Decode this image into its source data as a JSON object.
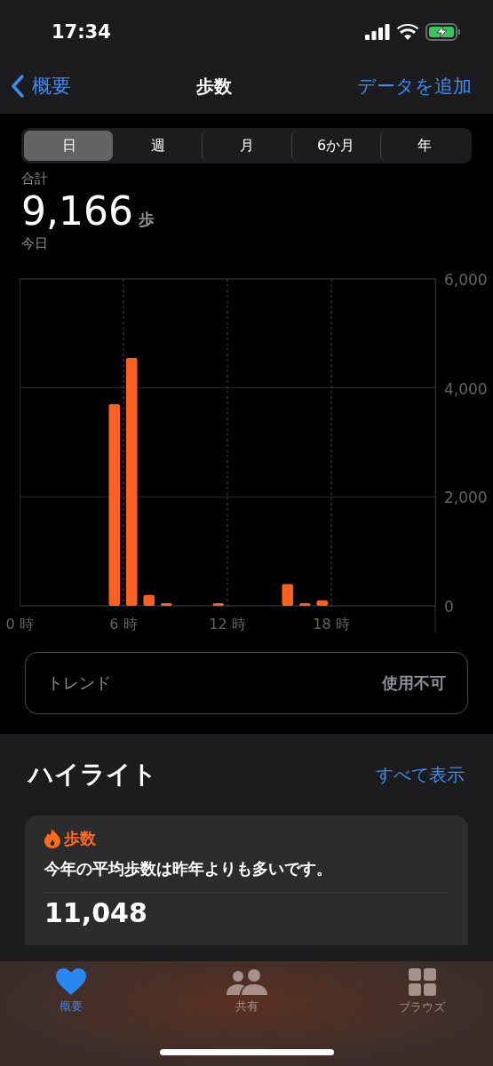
{
  "status_bar": {
    "time": "17:34"
  },
  "nav": {
    "back": "概要",
    "title": "歩数",
    "action": "データを追加"
  },
  "segments": [
    {
      "label": "日",
      "selected": true
    },
    {
      "label": "週",
      "selected": false
    },
    {
      "label": "月",
      "selected": false
    },
    {
      "label": "6か月",
      "selected": false
    },
    {
      "label": "年",
      "selected": false
    }
  ],
  "summary": {
    "label": "合計",
    "value": "9,166",
    "unit": "歩",
    "period": "今日"
  },
  "chart_data": {
    "type": "bar",
    "x": [
      5.5,
      6.5,
      7.5,
      8.5,
      11.5,
      15.5,
      16.5,
      17.5
    ],
    "grid": true,
    "series": [
      {
        "color": "#ff5f1f",
        "values": [
          3700,
          4550,
          200,
          50,
          50,
          400,
          50,
          100
        ]
      }
    ],
    "xlim": [
      0,
      24
    ],
    "ylim": [
      0,
      6000
    ],
    "yticks": [
      {
        "value": 0,
        "label": "0"
      },
      {
        "value": 2000,
        "label": "2,000"
      },
      {
        "value": 4000,
        "label": "4,000"
      },
      {
        "value": 6000,
        "label": "6,000"
      }
    ],
    "xticks": [
      {
        "value": 0,
        "label": "0 時"
      },
      {
        "value": 6,
        "label": "6 時"
      },
      {
        "value": 12,
        "label": "12 時"
      },
      {
        "value": 18,
        "label": "18 時"
      }
    ]
  },
  "trend": {
    "label": "トレンド",
    "value": "使用不可"
  },
  "highlights": {
    "title": "ハイライト",
    "link": "すべて表示",
    "card": {
      "category": "歩数",
      "text": "今年の平均歩数は昨年よりも多いです。",
      "value": "11,048"
    }
  },
  "tab_bar": [
    {
      "label": "概要",
      "kind": "heart",
      "selected": true
    },
    {
      "label": "共有",
      "kind": "people",
      "selected": false
    },
    {
      "label": "ブラウズ",
      "kind": "grid",
      "selected": false
    }
  ]
}
